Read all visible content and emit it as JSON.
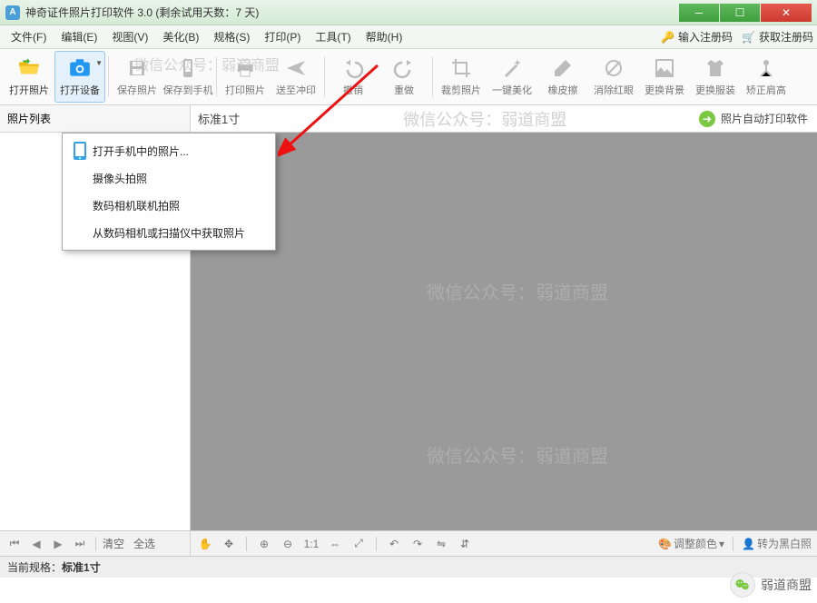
{
  "titlebar": {
    "logo_letter": "A",
    "title": "神奇证件照片打印软件 3.0 (剩余试用天数：7 天)"
  },
  "menu": {
    "items": [
      "文件(F)",
      "编辑(E)",
      "视图(V)",
      "美化(B)",
      "规格(S)",
      "打印(P)",
      "工具(T)",
      "帮助(H)"
    ],
    "enter_code": "输入注册码",
    "get_code": "获取注册码"
  },
  "toolbar": {
    "items": [
      {
        "label": "打开照片",
        "enabled": true,
        "icon": "folder-open"
      },
      {
        "label": "打开设备",
        "enabled": true,
        "icon": "camera",
        "active": true,
        "dd": true
      },
      {
        "label": "保存照片",
        "enabled": false,
        "icon": "save"
      },
      {
        "label": "保存到手机",
        "enabled": false,
        "icon": "save-phone"
      },
      {
        "label": "打印照片",
        "enabled": false,
        "icon": "printer"
      },
      {
        "label": "送至冲印",
        "enabled": false,
        "icon": "send"
      },
      {
        "label": "撤销",
        "enabled": false,
        "icon": "undo"
      },
      {
        "label": "重做",
        "enabled": false,
        "icon": "redo"
      },
      {
        "label": "裁剪照片",
        "enabled": false,
        "icon": "crop"
      },
      {
        "label": "一键美化",
        "enabled": false,
        "icon": "magic"
      },
      {
        "label": "橡皮擦",
        "enabled": false,
        "icon": "eraser"
      },
      {
        "label": "消除红眼",
        "enabled": false,
        "icon": "redeye"
      },
      {
        "label": "更换背景",
        "enabled": false,
        "icon": "bg"
      },
      {
        "label": "更换服装",
        "enabled": false,
        "icon": "shirt"
      },
      {
        "label": "矫正肩高",
        "enabled": false,
        "icon": "align"
      }
    ],
    "sep_after": [
      1,
      3,
      5,
      7
    ]
  },
  "secbar": {
    "left_label": "照片列表",
    "right_label": "标准1寸",
    "right_link": "照片自动打印软件"
  },
  "dropdown": {
    "items": [
      {
        "label": "打开手机中的照片...",
        "icon": "phone"
      },
      {
        "label": "摄像头拍照",
        "icon": ""
      },
      {
        "label": "数码相机联机拍照",
        "icon": ""
      },
      {
        "label": "从数码相机或扫描仪中获取照片",
        "icon": ""
      }
    ]
  },
  "sidefoot": {
    "clear": "清空",
    "select_all": "全选"
  },
  "canvasbar": {
    "adjust_color": "调整颜色",
    "to_bw": "转为黑白照"
  },
  "statusbar": {
    "label": "当前规格：",
    "value": "标准1寸"
  },
  "watermarks": {
    "text": "微信公众号：弱道商盟"
  },
  "wechat_overlay": "弱道商盟"
}
